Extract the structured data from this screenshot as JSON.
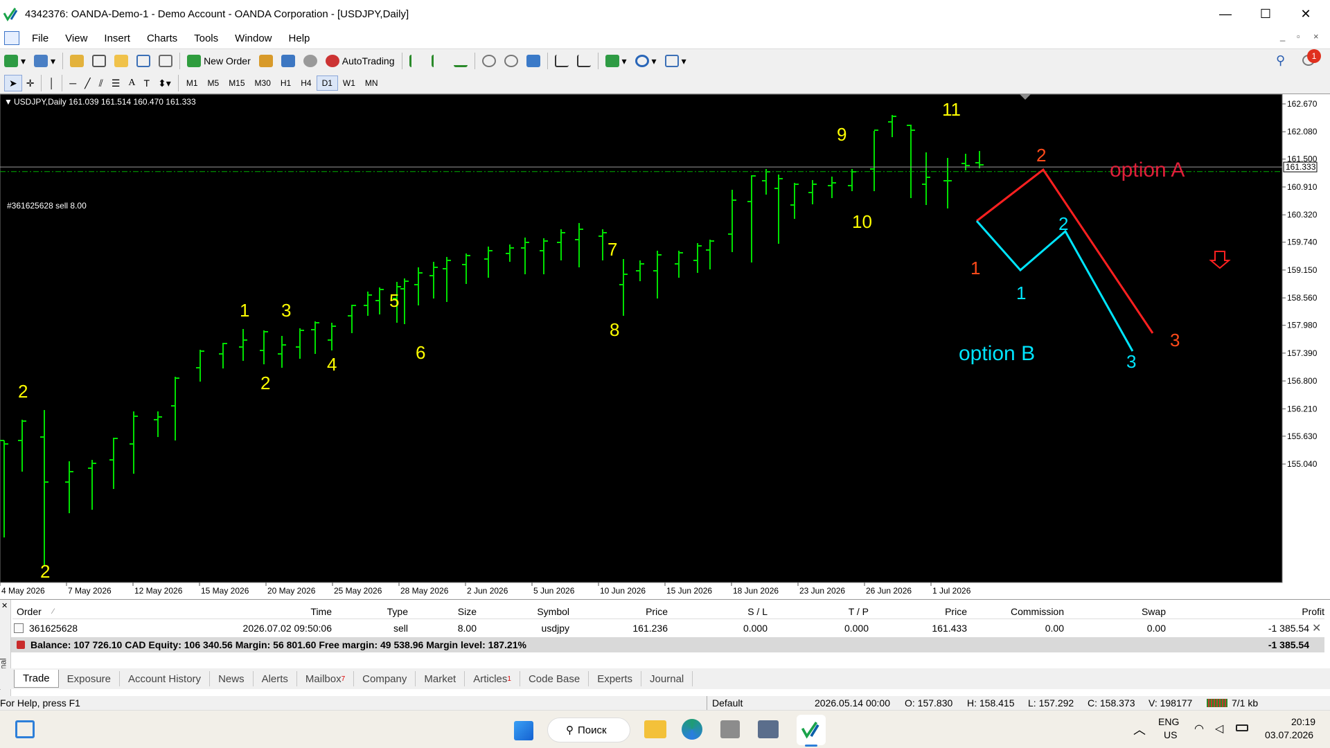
{
  "window": {
    "title": "4342376: OANDA-Demo-1 - Demo Account - OANDA Corporation - [USDJPY,Daily]",
    "minimize": "—",
    "maximize": "☐",
    "close": "✕"
  },
  "menu": [
    "File",
    "View",
    "Insert",
    "Charts",
    "Tools",
    "Window",
    "Help"
  ],
  "toolbar": {
    "new_order": "New Order",
    "autotrading": "AutoTrading",
    "notification_count": "1"
  },
  "timeframes": [
    "M1",
    "M5",
    "M15",
    "M30",
    "H1",
    "H4",
    "D1",
    "W1",
    "MN"
  ],
  "selected_timeframe": "D1",
  "chart": {
    "header": "USDJPY,Daily  161.039 161.514 160.470 161.333",
    "order_line_label": "#361625628 sell 8.00",
    "current_price_label": "161.333",
    "price_levels": [
      "162.670",
      "162.080",
      "161.500",
      "160.910",
      "160.320",
      "159.740",
      "159.150",
      "158.560",
      "157.980",
      "157.390",
      "156.800",
      "156.210",
      "155.630",
      "155.040"
    ],
    "date_labels": [
      "4 May 2026",
      "7 May 2026",
      "12 May 2026",
      "15 May 2026",
      "20 May 2026",
      "25 May 2026",
      "28 May 2026",
      "2 Jun 2026",
      "5 Jun 2026",
      "10 Jun 2026",
      "15 Jun 2026",
      "18 Jun 2026",
      "23 Jun 2026",
      "26 Jun 2026",
      "1 Jul 2026"
    ],
    "wave_labels": [
      "2",
      "2",
      "1",
      "3",
      "2",
      "4",
      "5",
      "6",
      "7",
      "8",
      "9",
      "10",
      "11"
    ],
    "option_a_label": "option  A",
    "option_b_label": "option B",
    "option_a_waves": [
      "1",
      "2",
      "3"
    ],
    "option_b_waves": [
      "1",
      "2",
      "3"
    ],
    "colors": {
      "bars": "#00e000",
      "wave_labels": "#ffff00",
      "option_a": "#ff2020",
      "option_a_text": "#e0203a",
      "option_a_wave": "#ff4a1a",
      "option_b": "#00e5ff",
      "background": "#000000",
      "order_line": "#00b000"
    }
  },
  "terminal": {
    "columns": [
      "Order",
      "Time",
      "Type",
      "Size",
      "Symbol",
      "Price",
      "S / L",
      "T / P",
      "Price",
      "Commission",
      "Swap",
      "Profit"
    ],
    "rows": [
      {
        "order": "361625628",
        "time": "2026.07.02 09:50:06",
        "type": "sell",
        "size": "8.00",
        "symbol": "usdjpy",
        "price": "161.236",
        "sl": "0.000",
        "tp": "0.000",
        "price2": "161.433",
        "commission": "0.00",
        "swap": "0.00",
        "profit": "-1 385.54"
      }
    ],
    "balance_line": "Balance: 107 726.10 CAD  Equity: 106 340.56  Margin: 56 801.60  Free margin: 49 538.96  Margin level: 187.21%",
    "balance_profit": "-1 385.54",
    "side_label": "Terminal"
  },
  "tabs": [
    {
      "label": "Trade",
      "badge": ""
    },
    {
      "label": "Exposure",
      "badge": ""
    },
    {
      "label": "Account History",
      "badge": ""
    },
    {
      "label": "News",
      "badge": ""
    },
    {
      "label": "Alerts",
      "badge": ""
    },
    {
      "label": "Mailbox",
      "badge": "7"
    },
    {
      "label": "Company",
      "badge": ""
    },
    {
      "label": "Market",
      "badge": ""
    },
    {
      "label": "Articles",
      "badge": "1"
    },
    {
      "label": "Code Base",
      "badge": ""
    },
    {
      "label": "Experts",
      "badge": ""
    },
    {
      "label": "Journal",
      "badge": ""
    }
  ],
  "active_tab": "Trade",
  "status": {
    "help": "For Help, press F1",
    "profile": "Default",
    "datetime": "2026.05.14 00:00",
    "open": "O: 157.830",
    "high": "H: 158.415",
    "low": "L: 157.292",
    "close": "C: 158.373",
    "volume": "V: 198177",
    "traffic": "7/1 kb"
  },
  "taskbar": {
    "search": "Поиск",
    "lang": "ENG",
    "region": "US",
    "time": "20:19",
    "date": "03.07.2026"
  }
}
